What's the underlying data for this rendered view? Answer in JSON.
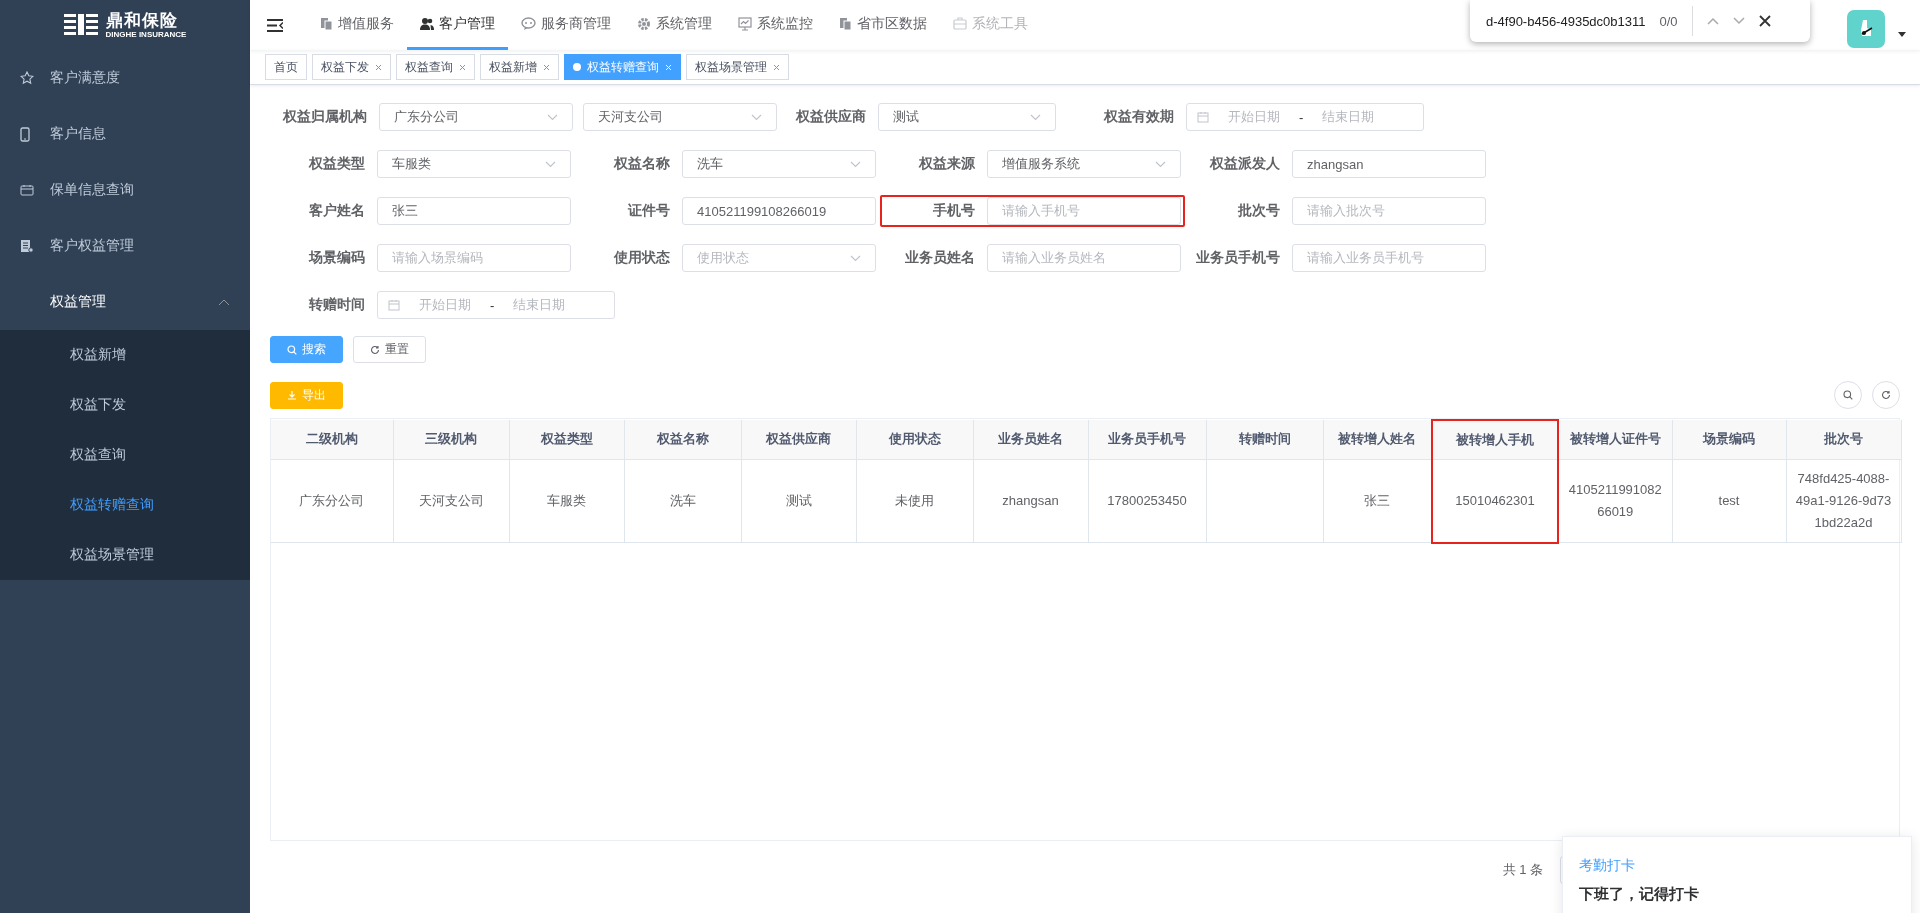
{
  "sidebar": {
    "logo": {
      "name": "鼎和保险",
      "subtitle": "DINGHE INSURANCE"
    },
    "items": [
      {
        "label": "客户满意度",
        "selected": false
      },
      {
        "label": "客户信息",
        "selected": false
      },
      {
        "label": "保单信息查询",
        "selected": false
      },
      {
        "label": "客户权益管理",
        "selected": false
      },
      {
        "label": "权益管理",
        "selected": false,
        "expanded": true,
        "children": [
          {
            "label": "权益新增",
            "selected": false
          },
          {
            "label": "权益下发",
            "selected": false
          },
          {
            "label": "权益查询",
            "selected": false
          },
          {
            "label": "权益转赠查询",
            "selected": true
          },
          {
            "label": "权益场景管理",
            "selected": false
          }
        ]
      }
    ]
  },
  "top_nav": {
    "items": [
      {
        "label": "增值服务",
        "selected": false,
        "disabled": false
      },
      {
        "label": "客户管理",
        "selected": true,
        "disabled": false
      },
      {
        "label": "服务商管理",
        "selected": false,
        "disabled": false
      },
      {
        "label": "系统管理",
        "selected": false,
        "disabled": false
      },
      {
        "label": "系统监控",
        "selected": false,
        "disabled": false
      },
      {
        "label": "省市区数据",
        "selected": false,
        "disabled": false
      },
      {
        "label": "系统工具",
        "selected": false,
        "disabled": true
      }
    ]
  },
  "find_bar": {
    "query": "d-4f90-b456-4935dc0b1311",
    "count": "0/0"
  },
  "tabs": [
    {
      "label": "首页",
      "selected": false,
      "closable": false
    },
    {
      "label": "权益下发",
      "selected": false,
      "closable": true
    },
    {
      "label": "权益查询",
      "selected": false,
      "closable": true
    },
    {
      "label": "权益新增",
      "selected": false,
      "closable": true
    },
    {
      "label": "权益转赠查询",
      "selected": true,
      "closable": true
    },
    {
      "label": "权益场景管理",
      "selected": false,
      "closable": true
    }
  ],
  "filters": [
    [
      {
        "label": "权益归属机构",
        "highlighted": false,
        "controls": [
          {
            "kind": "select",
            "value": "广东分公司"
          },
          {
            "kind": "select",
            "value": "天河支公司"
          }
        ]
      },
      {
        "label": "权益供应商",
        "highlighted": false,
        "controls": [
          {
            "kind": "select",
            "value": "测试"
          }
        ]
      },
      {
        "label": "权益有效期",
        "highlighted": false,
        "controls": [
          {
            "kind": "daterange",
            "start": "开始日期",
            "separator": "-",
            "end": "结束日期"
          }
        ]
      }
    ],
    [
      {
        "label": "权益类型",
        "highlighted": false,
        "controls": [
          {
            "kind": "select",
            "value": "车服类"
          }
        ]
      },
      {
        "label": "权益名称",
        "highlighted": false,
        "controls": [
          {
            "kind": "select",
            "value": "洗车"
          }
        ]
      },
      {
        "label": "权益来源",
        "highlighted": false,
        "controls": [
          {
            "kind": "select",
            "value": "增值服务系统"
          }
        ]
      },
      {
        "label": "权益派发人",
        "highlighted": false,
        "controls": [
          {
            "kind": "input",
            "value": "zhangsan"
          }
        ]
      }
    ],
    [
      {
        "label": "客户姓名",
        "highlighted": false,
        "controls": [
          {
            "kind": "input",
            "value": "张三"
          }
        ]
      },
      {
        "label": "证件号",
        "highlighted": false,
        "controls": [
          {
            "kind": "input",
            "value": "410521199108266019"
          }
        ]
      },
      {
        "label": "手机号",
        "highlighted": true,
        "controls": [
          {
            "kind": "input",
            "placeholder": "请输入手机号"
          }
        ]
      },
      {
        "label": "批次号",
        "highlighted": false,
        "controls": [
          {
            "kind": "input",
            "placeholder": "请输入批次号"
          }
        ]
      }
    ],
    [
      {
        "label": "场景编码",
        "highlighted": false,
        "controls": [
          {
            "kind": "input",
            "placeholder": "请输入场景编码"
          }
        ]
      },
      {
        "label": "使用状态",
        "highlighted": false,
        "controls": [
          {
            "kind": "select",
            "placeholder": "使用状态"
          }
        ]
      },
      {
        "label": "业务员姓名",
        "highlighted": false,
        "controls": [
          {
            "kind": "input",
            "placeholder": "请输入业务员姓名"
          }
        ]
      },
      {
        "label": "业务员手机号",
        "highlighted": false,
        "controls": [
          {
            "kind": "input",
            "placeholder": "请输入业务员手机号"
          }
        ]
      }
    ],
    [
      {
        "label": "转赠时间",
        "highlighted": false,
        "controls": [
          {
            "kind": "daterange",
            "start": "开始日期",
            "separator": "-",
            "end": "结束日期"
          }
        ]
      }
    ]
  ],
  "actions": {
    "search": "搜索",
    "reset": "重置",
    "export": "导出"
  },
  "table": {
    "columns": [
      {
        "label": "二级机构",
        "highlighted": false
      },
      {
        "label": "三级机构",
        "highlighted": false
      },
      {
        "label": "权益类型",
        "highlighted": false
      },
      {
        "label": "权益名称",
        "highlighted": false
      },
      {
        "label": "权益供应商",
        "highlighted": false
      },
      {
        "label": "使用状态",
        "highlighted": false
      },
      {
        "label": "业务员姓名",
        "highlighted": false
      },
      {
        "label": "业务员手机号",
        "highlighted": false
      },
      {
        "label": "转赠时间",
        "highlighted": false
      },
      {
        "label": "被转增人姓名",
        "highlighted": false
      },
      {
        "label": "被转增人手机",
        "highlighted": true
      },
      {
        "label": "被转增人证件号",
        "highlighted": false
      },
      {
        "label": "场景编码",
        "highlighted": false
      },
      {
        "label": "批次号",
        "highlighted": false
      }
    ],
    "rows": [
      [
        "广东分公司",
        "天河支公司",
        "车服类",
        "洗车",
        "测试",
        "未使用",
        "zhangsan",
        "17800253450",
        "",
        "张三",
        "15010462301",
        "410521199108266019",
        "test",
        "748fd425-4088-49a1-9126-9d731bd22a2d"
      ]
    ]
  },
  "pagination": {
    "total": "共 1 条"
  },
  "notification": {
    "title": "考勤打卡",
    "message": "下班了，记得打卡"
  }
}
